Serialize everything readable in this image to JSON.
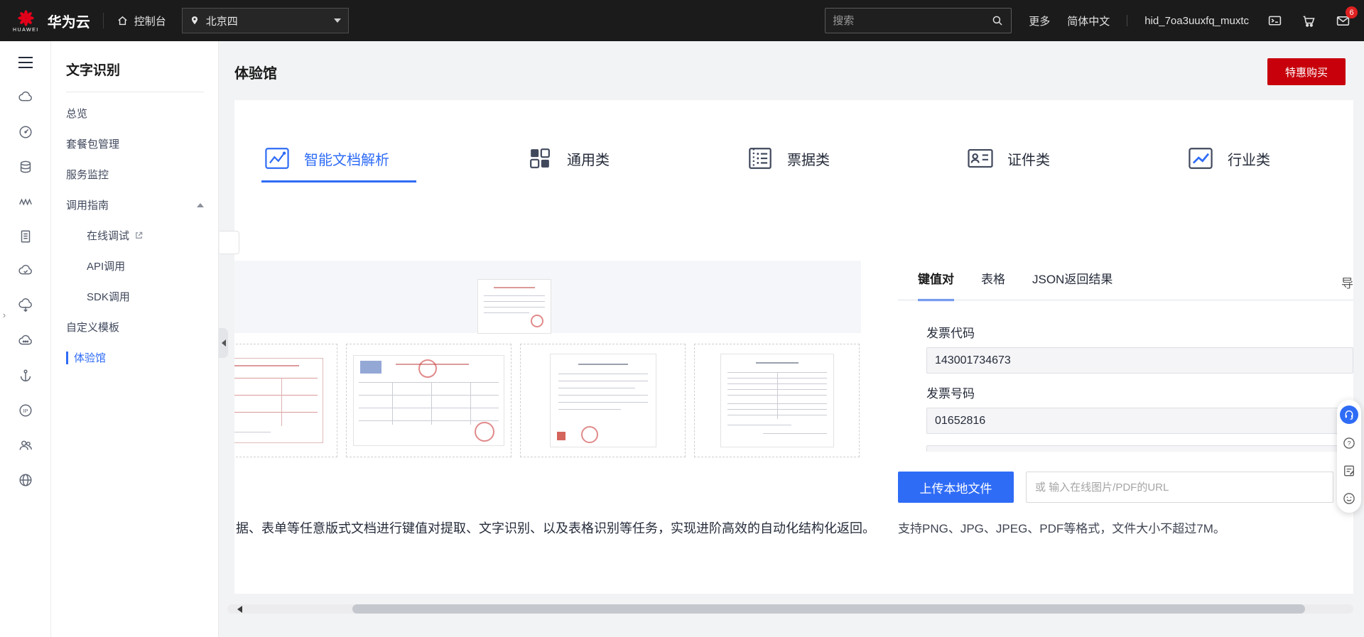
{
  "colors": {
    "accent": "#2F6CF6",
    "brand_red": "#C7000B"
  },
  "topbar": {
    "logo_text": "HUAWEI",
    "brand": "华为云",
    "console": "控制台",
    "region": "北京四",
    "search_placeholder": "搜索",
    "more": "更多",
    "language": "简体中文",
    "username": "hid_7oa3uuxfq_muxtc",
    "mail_badge": "6"
  },
  "sidebar": {
    "title": "文字识别",
    "items": [
      {
        "label": "总览"
      },
      {
        "label": "套餐包管理"
      },
      {
        "label": "服务监控"
      },
      {
        "label": "调用指南"
      },
      {
        "label": "在线调试"
      },
      {
        "label": "API调用"
      },
      {
        "label": "SDK调用"
      },
      {
        "label": "自定义模板"
      },
      {
        "label": "体验馆"
      }
    ]
  },
  "page": {
    "title": "体验馆",
    "buy_button": "特惠购买"
  },
  "tabs": [
    {
      "label": "智能文档解析"
    },
    {
      "label": "通用类"
    },
    {
      "label": "票据类"
    },
    {
      "label": "证件类"
    },
    {
      "label": "行业类"
    }
  ],
  "preview": {
    "description": "据、表单等任意版式文档进行键值对提取、文字识别、以及表格识别等任务，实现进阶高效的自动化结构化返回。"
  },
  "result": {
    "tabs": [
      {
        "label": "键值对"
      },
      {
        "label": "表格"
      },
      {
        "label": "JSON返回结果"
      }
    ],
    "export_clipped": "导",
    "fields": [
      {
        "label": "发票代码",
        "value": "143001734673"
      },
      {
        "label": "发票号码",
        "value": "01652816"
      }
    ],
    "upload_button": "上传本地文件",
    "url_placeholder": "或 输入在线图片/PDF的URL",
    "format_note": "支持PNG、JPG、JPEG、PDF等格式，文件大小不超过7M。"
  }
}
